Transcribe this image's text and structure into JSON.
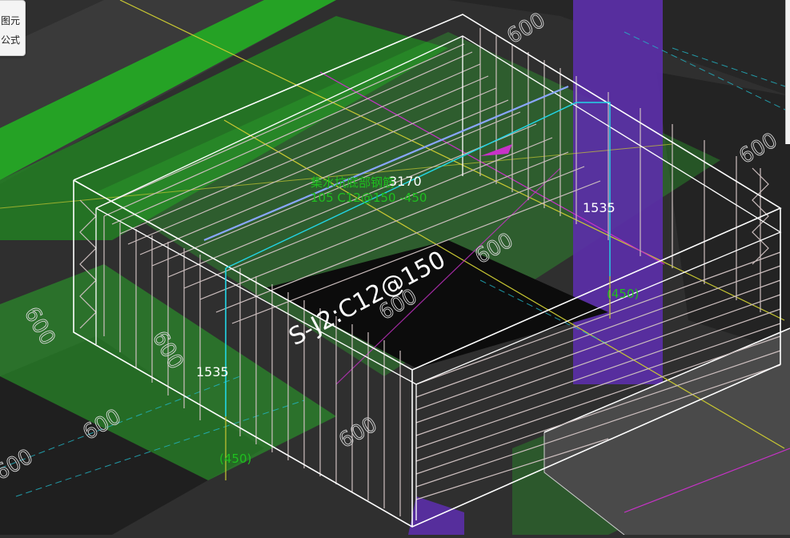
{
  "menu": {
    "items": [
      "图元",
      "公式"
    ]
  },
  "colors": {
    "background": "#2f2f2f",
    "slab_green": "#24a824",
    "pit_purple": "#5b2fa8",
    "wireframe": "#ffffff",
    "rebar": "#cdbfbf",
    "dimension": "#ffffff",
    "annotation_green": "#1fbf1f",
    "axis_yellow": "#c9c832",
    "axis_magenta": "#c832c8",
    "highlight_cyan": "#22d6e6",
    "highlight_blue": "#8aa6ff"
  },
  "labels": {
    "top_length": "3170",
    "right_height": "1535",
    "left_height": "1535",
    "right_depth": "(450)",
    "left_depth": "(450)",
    "rebar_text": "S-J2:C12@150",
    "green_line1": "集水坑底部钢筋",
    "green_line2": "105 C12@150  -450"
  },
  "grid_labels": [
    "600",
    "600",
    "600",
    "600",
    "600",
    "600",
    "600",
    "600",
    "600"
  ]
}
